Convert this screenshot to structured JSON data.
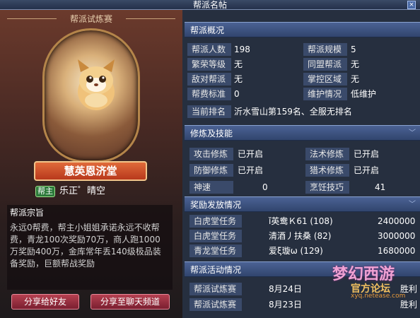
{
  "window": {
    "title": "帮派名帖",
    "close_label": "×"
  },
  "left": {
    "header": "帮派试炼赛",
    "guild_name": "慧英恩济堂",
    "leader_tag": "帮主",
    "leader_name": "乐正゜晴空",
    "creed_title": "帮派宗旨",
    "creed_text": "永远0帮费，帮主小姐姐承诺永远不收帮费，青龙100次奖励70万，商人跑1000万奖励400万，金库常年丢140级极品装备奖励，巨额帮战奖励",
    "share_friend": "分享给好友",
    "share_chat": "分享至聊天频道"
  },
  "overview": {
    "title": "帮派概况",
    "rows": [
      {
        "l1": "帮派人数",
        "v1": "198",
        "l2": "帮派规模",
        "v2": "5"
      },
      {
        "l1": "繁荣等级",
        "v1": "无",
        "l2": "同盟帮派",
        "v2": "无"
      },
      {
        "l1": "敌对帮派",
        "v1": "无",
        "l2": "掌控区域",
        "v2": "无"
      },
      {
        "l1": "帮费标准",
        "v1": "0",
        "l2": "维护情况",
        "v2": "低维护"
      }
    ],
    "rank_label": "当前排名",
    "rank_value": "沂水雪山第159名、全服无排名"
  },
  "skills": {
    "title": "修炼及技能",
    "rows": [
      {
        "l1": "攻击修炼",
        "v1": "已开启",
        "l2": "法术修炼",
        "v2": "已开启"
      },
      {
        "l1": "防御修炼",
        "v1": "已开启",
        "l2": "猎术修炼",
        "v2": "已开启"
      },
      {
        "l1": "神速",
        "v1": "0",
        "l2": "烹饪技巧",
        "v2": "41"
      }
    ]
  },
  "rewards": {
    "title": "奖励发放情况",
    "rows": [
      {
        "task": "白虎堂任务",
        "name": "ǐ英鸯Ｋ61 (108)",
        "amount": "2400000"
      },
      {
        "task": "白虎堂任务",
        "name": "清酒丿扶桑 (82)",
        "amount": "3000000"
      },
      {
        "task": "青龙堂任务",
        "name": "爱ξ璇ω (129)",
        "amount": "1680000"
      }
    ]
  },
  "activity": {
    "title": "帮派活动情况",
    "rows": [
      {
        "event": "帮派试炼赛",
        "date": "8月24日",
        "result": "胜利"
      },
      {
        "event": "帮派试炼赛",
        "date": "8月23日",
        "result": "胜利"
      }
    ]
  },
  "watermark": {
    "logo": "梦幻西游",
    "sub": "官方论坛",
    "url": "xyq.netease.com"
  },
  "icons": [
    "chevron-down-icon",
    "close-icon",
    "mascot-cat-icon"
  ]
}
